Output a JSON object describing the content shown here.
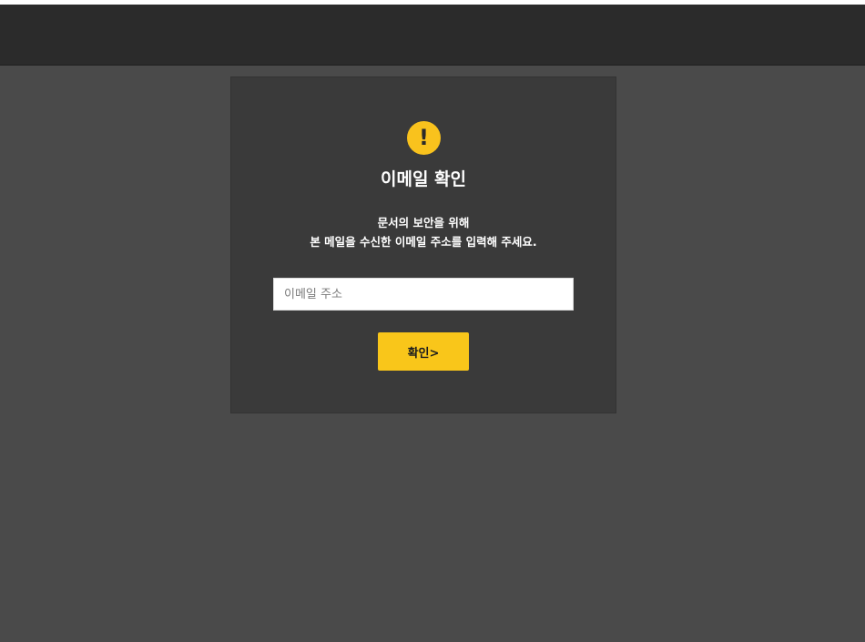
{
  "dialog": {
    "icon": "warning-icon",
    "icon_glyph": "!",
    "title": "이메일 확인",
    "description_line1": "문서의 보안을 위해",
    "description_line2": "본 메일을 수신한 이메일 주소를 입력해 주세요.",
    "email_placeholder": "이메일 주소",
    "email_value": "",
    "confirm_label": "확인>"
  },
  "colors": {
    "accent": "#f9c61a",
    "background": "#4a4a4a",
    "header": "#2b2b2b",
    "card": "#3a3a3a"
  }
}
